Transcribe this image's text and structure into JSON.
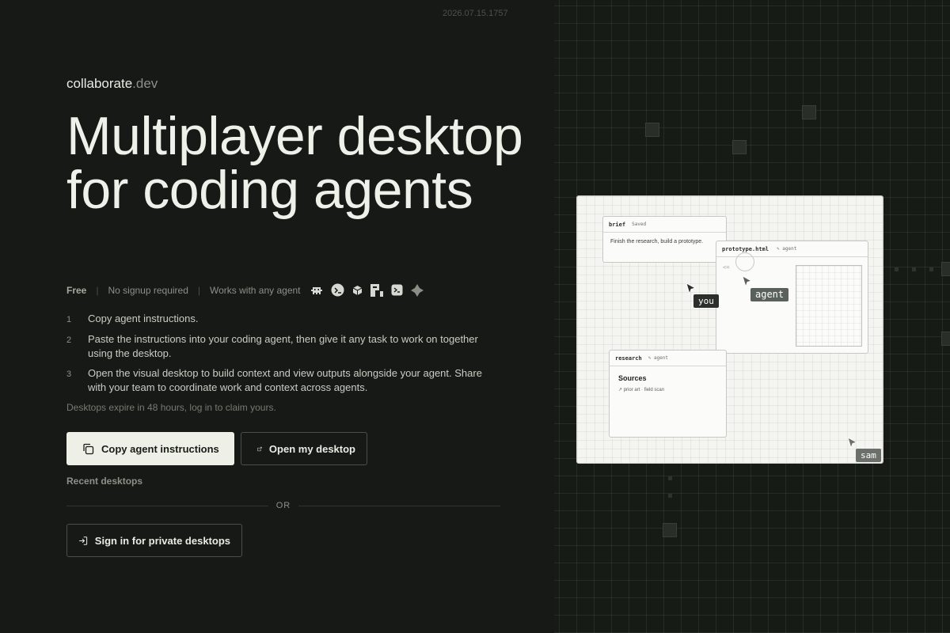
{
  "timestamp": "2026.07.15.1757",
  "brand": {
    "name": "collaborate",
    "tld": ".dev"
  },
  "headline": "Multiplayer desktop for coding agents",
  "meta": {
    "free": "Free",
    "no_signup": "No signup required",
    "works_with": "Works with any agent",
    "agent_icons": [
      "claude-icon",
      "openclaw-icon",
      "cursor-icon",
      "opencode-icon",
      "codex-icon",
      "gemini-icon"
    ]
  },
  "steps": [
    {
      "num": "1",
      "text": "Copy agent instructions."
    },
    {
      "num": "2",
      "text": "Paste the instructions into your coding agent, then give it any task to work on together using the desktop."
    },
    {
      "num": "3",
      "text": "Open the visual desktop to build context and view outputs alongside your agent. Share with your team to coordinate work and context across agents."
    }
  ],
  "expire_note": "Desktops expire in 48 hours, log in to claim yours.",
  "buttons": {
    "copy": "Copy agent instructions",
    "open": "Open my desktop",
    "signin": "Sign in for private desktops"
  },
  "recent": "Recent desktops",
  "or": "OR",
  "preview": {
    "brief": {
      "title": "brief",
      "status": "Saved",
      "body": "Finish the research, build a prototype."
    },
    "prototype": {
      "title": "prototype.html",
      "by": "✎ agent",
      "arrow": "<="
    },
    "research": {
      "title": "research",
      "by": "✎ agent",
      "heading": "Sources",
      "line": "↗ prior art · field scan"
    },
    "cursors": {
      "you": "you",
      "agent": "agent",
      "sam": "sam"
    }
  },
  "colors": {
    "background": "#161915",
    "primary_button": "#eef0e8",
    "text": "#e8ece4",
    "muted": "#8b9188"
  }
}
